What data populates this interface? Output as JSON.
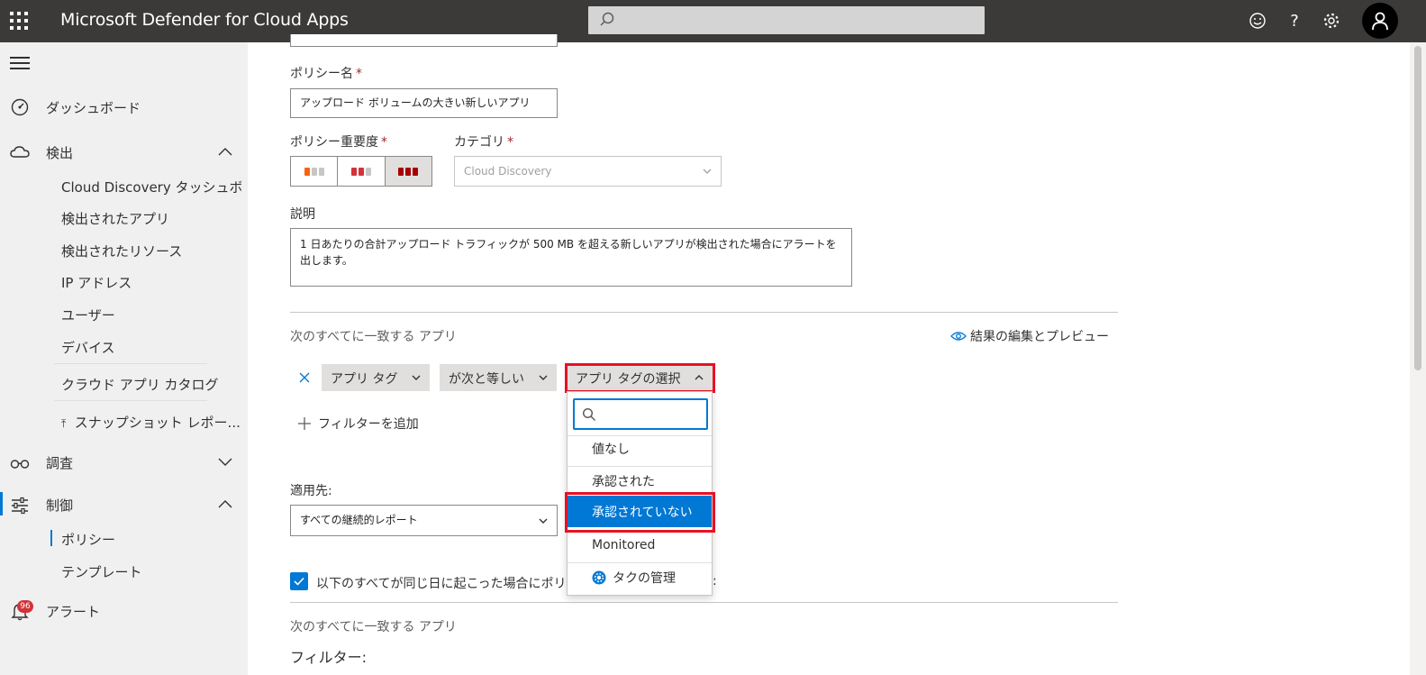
{
  "header": {
    "app_title": "Microsoft Defender for Cloud Apps",
    "search_placeholder": "",
    "icons": [
      "waffle-icon",
      "search-icon",
      "smiley-icon",
      "help-icon",
      "settings-icon",
      "user-avatar-icon"
    ]
  },
  "sidebar": {
    "items": [
      {
        "label": "ダッシュボード",
        "icon": "dashboard-icon"
      },
      {
        "label": "検出",
        "icon": "cloud-icon"
      },
      {
        "label": "調査",
        "icon": "glasses-icon"
      },
      {
        "label": "制御",
        "icon": "sliders-icon"
      },
      {
        "label": "アラート",
        "icon": "bell-icon",
        "badge": "96"
      }
    ],
    "discovery_sub": [
      "Cloud Discovery タッシュボ...",
      "検出されたアプリ",
      "検出されたリソース",
      "IP アドレス",
      "ユーザー",
      "デバイス",
      "クラウド アプリ カタログ",
      "スナップショット レポー..."
    ],
    "control_sub": [
      "ポリシー",
      "テンプレート"
    ],
    "snapshot_prefix_icon": "upload-icon"
  },
  "form": {
    "policy_name_label": "ポリシー名",
    "required_mark": "*",
    "policy_name_value": "アップロード ボリュームの大きい新しいアプリ",
    "severity_label": "ポリシー重要度",
    "severity_levels": [
      "low",
      "medium",
      "high"
    ],
    "severity_selected": "high",
    "category_label": "カテゴリ",
    "category_value": "Cloud Discovery",
    "description_label": "説明",
    "description_value": "1 日あたりの合計アップロード トラフィックが 500 MB を超える新しいアプリが検出された場合にアラートを出します。",
    "apps_match_label": "次のすべてに一致する アプリ",
    "edit_preview_label": "結果の編集とプレビュー",
    "filter": {
      "field": "アプリ タグ",
      "operator": "が次と等しい",
      "value_placeholder": "アプリ タグの選択"
    },
    "add_filter_label": "フィルターを追加",
    "apply_to_label": "適用先:",
    "apply_to_value": "すべての継続的レポート",
    "same_day_text": "以下のすべてが同じ日に起こった場合にポリ",
    "same_day_suffix": ":",
    "apps_match_label_2": "次のすべてに一致する アプリ",
    "filters_label": "フィルター:"
  },
  "dropdown": {
    "search_value": "",
    "options": [
      "値なし",
      "承認された",
      "承認されていない",
      "Monitored"
    ],
    "selected": "承認されていない",
    "manage_label": "タクの管理"
  },
  "colors": {
    "topbar": "#3b3a39",
    "accent": "#0078d4",
    "highlight": "#e81123",
    "sidebar_bg": "#f0f0f0",
    "sev_low": "#f7630c",
    "sev_medium": "#d13438",
    "sev_high": "#a80000"
  }
}
